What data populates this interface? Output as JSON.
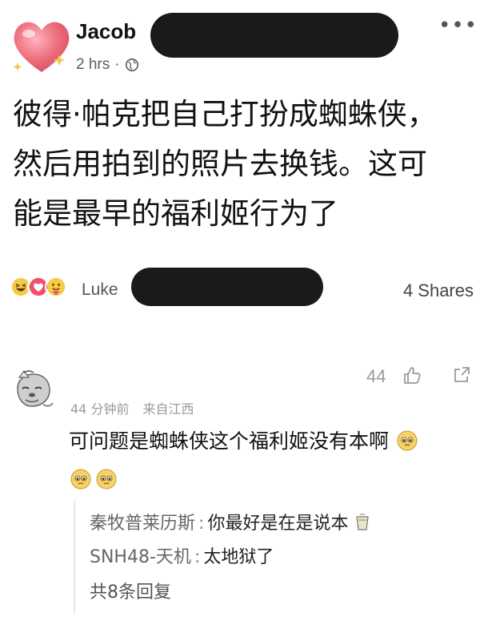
{
  "post": {
    "author": "Jacob",
    "time": "2 hrs",
    "separator": "·",
    "more_label": "•••",
    "text": "彼得·帕克把自己打扮成蜘蛛侠，\n然后用拍到的照片去换钱。这可\n能是最早的福利姬行为了"
  },
  "reactions": {
    "reactor_name": "Luke",
    "shares": "4 Shares"
  },
  "comment": {
    "likes": "44",
    "time": "44 分钟前",
    "location": "来自江西",
    "text": "可问题是蜘蛛侠这个福利姬没有本啊",
    "replies": [
      {
        "name": "秦牧普莱历斯",
        "sep": ":",
        "body": "你最好是在是说本"
      },
      {
        "name": "SNH48-天机",
        "sep": ":",
        "body": "太地狱了"
      }
    ],
    "more_replies": "共8条回复"
  },
  "colors": {
    "heart": "#ec6b7a",
    "redaction": "#1a1a1c",
    "meta_gray": "#9a9a9a"
  },
  "icons": [
    "heart-avatar-icon",
    "globe-icon",
    "more-icon",
    "haha-reaction-icon",
    "love-reaction-icon",
    "care-reaction-icon",
    "cat-avatar-icon",
    "thumbs-up-icon",
    "share-icon",
    "pleading-face-icon",
    "tea-emoji-icon"
  ]
}
